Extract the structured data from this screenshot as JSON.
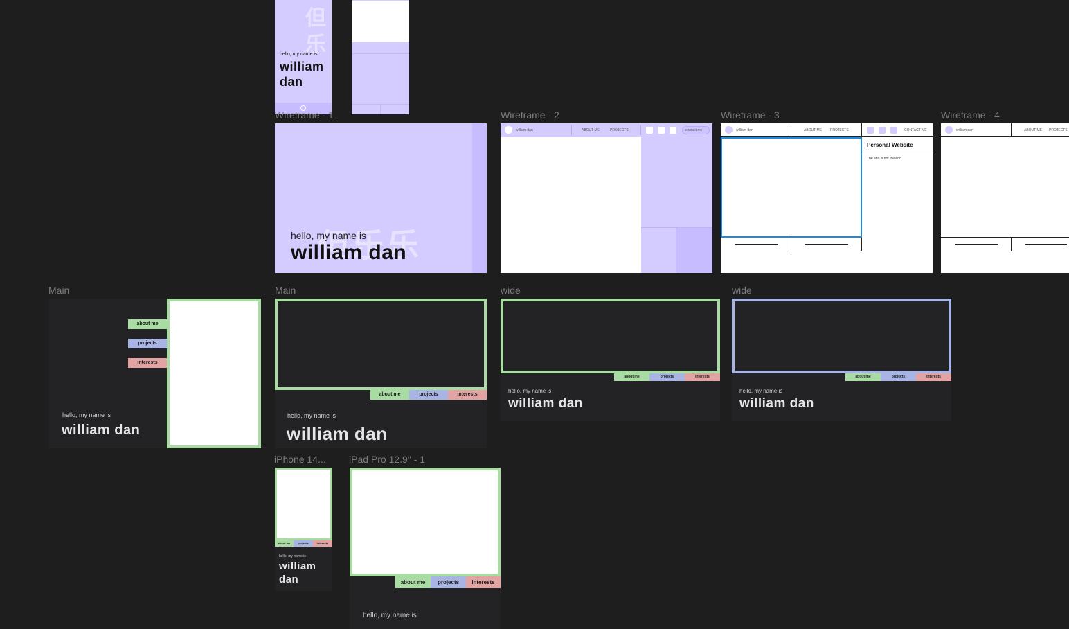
{
  "frames": {
    "wf1": "Wireframe - 1",
    "wf2": "Wireframe - 2",
    "wf3": "Wireframe - 3",
    "wf4": "Wireframe - 4",
    "main": "Main",
    "wide": "wide",
    "iphone": "iPhone 14...",
    "ipad": "iPad Pro 12.9\" - 1"
  },
  "intro": {
    "hello": "hello, my name is",
    "name": "william dan",
    "first": "william",
    "last": "dan"
  },
  "cjk": {
    "vertical": "但乐",
    "horizontal": "但乐乐"
  },
  "nav": {
    "about": "about me",
    "projects": "projects",
    "interests": "interests"
  },
  "wire": {
    "site_name": "william dan",
    "about": "ABOUT ME",
    "projects": "PROJECTS",
    "contact": "contact me",
    "contact_caps": "CONTACT ME",
    "panel_title": "Personal Website",
    "panel_text": "The end is not the end."
  },
  "colors": {
    "lavender": "#d4ccff",
    "green": "#a9dca2",
    "blue": "#a7b4e4",
    "red": "#e3a3a3",
    "selection": "#1e8bde"
  }
}
